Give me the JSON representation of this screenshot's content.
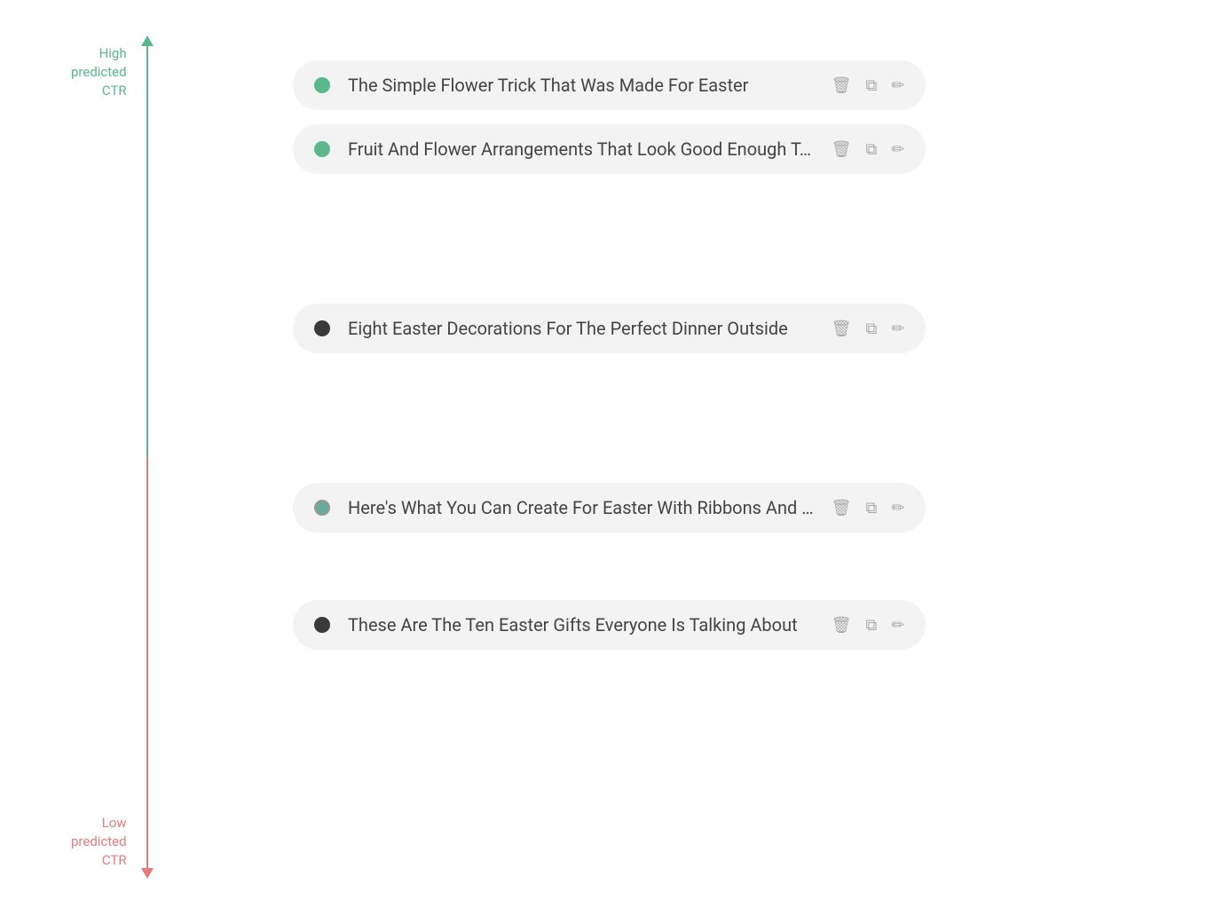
{
  "axis": {
    "high_label": [
      "High",
      "predicted",
      "CTR"
    ],
    "low_label": [
      "Low",
      "predicted",
      "CTR"
    ],
    "high_color": "#5ab88c",
    "low_color": "#e87a7a"
  },
  "items": [
    {
      "id": 1,
      "title": "The Simple Flower Trick That Was Made For Easter",
      "dot_type": "green",
      "position": "high"
    },
    {
      "id": 2,
      "title": "Fruit And Flower Arrangements That Look Good Enough T…",
      "dot_type": "green",
      "position": "high"
    },
    {
      "id": 3,
      "title": "Eight Easter Decorations For The Perfect Dinner Outside",
      "dot_type": "dark",
      "position": "mid"
    },
    {
      "id": 4,
      "title": "Here's What You Can Create For Easter With Ribbons And …",
      "dot_type": "teal",
      "position": "low-mid"
    },
    {
      "id": 5,
      "title": "These Are The Ten Easter Gifts Everyone Is Talking About",
      "dot_type": "dark",
      "position": "low"
    }
  ],
  "icons": {
    "delete": "🗑",
    "copy": "⧉",
    "edit": "✏"
  }
}
